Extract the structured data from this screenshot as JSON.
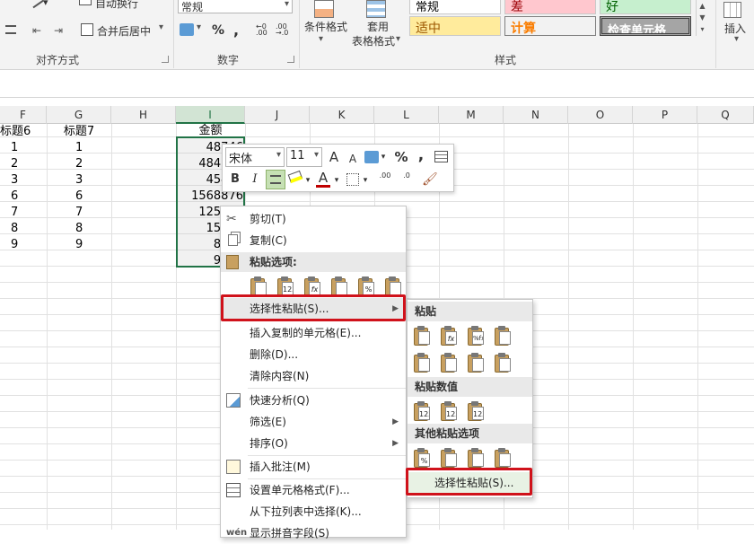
{
  "ribbon": {
    "wrap_text": "自动换行",
    "merge_center": "合并后居中",
    "align_group": "对齐方式",
    "number_format": "常规",
    "percent": "%",
    "comma": ",",
    "number_group": "数字",
    "conditional_format": "条件格式",
    "table_format_line1": "套用",
    "table_format_line2": "表格格式",
    "style_normal": "常规",
    "style_bad": "差",
    "style_good": "好",
    "style_neutral": "适中",
    "style_calc": "计算",
    "style_check": "检查单元格",
    "styles_group": "样式",
    "insert": "插入",
    "colors": {
      "bad_bg": "#ffc7ce",
      "good_bg": "#c6efce",
      "neutral_bg": "#ffeb9c",
      "calc_bg": "#f2f2f2",
      "check_bg": "#a5a5a5",
      "accent": "#217346"
    }
  },
  "columns": [
    "F",
    "G",
    "H",
    "I",
    "J",
    "K",
    "L",
    "M",
    "N",
    "O",
    "P",
    "Q"
  ],
  "selected_column": "I",
  "sheet": {
    "headers": {
      "F": "标题6",
      "G": "标题7",
      "I": "金额"
    },
    "rows": [
      {
        "F": "1",
        "G": "1",
        "I": "48746"
      },
      {
        "F": "2",
        "G": "2",
        "I": "484815"
      },
      {
        "F": "3",
        "G": "3",
        "I": "45486"
      },
      {
        "F": "6",
        "G": "6",
        "I": "1568876"
      },
      {
        "F": "7",
        "G": "7",
        "I": "125845"
      },
      {
        "F": "8",
        "G": "8",
        "I": "15257"
      },
      {
        "F": "9",
        "G": "9",
        "I": "8965"
      },
      {
        "F": "",
        "G": "",
        "I": "9415"
      }
    ]
  },
  "mini_toolbar": {
    "font_name": "宋体",
    "font_size": "11",
    "grow_font": "A",
    "shrink_font": "A",
    "percent": "%",
    "comma": ",",
    "bold": "B",
    "italic": "I",
    "font_color": "A",
    "dec_increase": ".00",
    "dec_decrease": ".0"
  },
  "context_menu": {
    "cut": "剪切(T)",
    "copy": "复制(C)",
    "paste_options_header": "粘贴选项:",
    "paste_special": "选择性粘贴(S)...",
    "insert_copied": "插入复制的单元格(E)...",
    "delete": "删除(D)...",
    "clear": "清除内容(N)",
    "quick_analysis": "快速分析(Q)",
    "filter": "筛选(E)",
    "sort": "排序(O)",
    "insert_comment": "插入批注(M)",
    "format_cells": "设置单元格格式(F)...",
    "pick_list": "从下拉列表中选择(K)...",
    "phonetic": "显示拼音字段(S)"
  },
  "paste_icons": {
    "paste_options": [
      "",
      "123",
      "fx",
      "",
      "%",
      ""
    ],
    "paste": [
      "",
      "fx",
      "%fx",
      "",
      "",
      "",
      "",
      ""
    ],
    "paste_values": [
      "123",
      "123",
      "123"
    ],
    "other_paste": [
      "%",
      "",
      "",
      ""
    ]
  },
  "submenu": {
    "paste_header": "粘贴",
    "values_header": "粘贴数值",
    "other_header": "其他粘贴选项",
    "paste_special": "选择性粘贴(S)..."
  }
}
